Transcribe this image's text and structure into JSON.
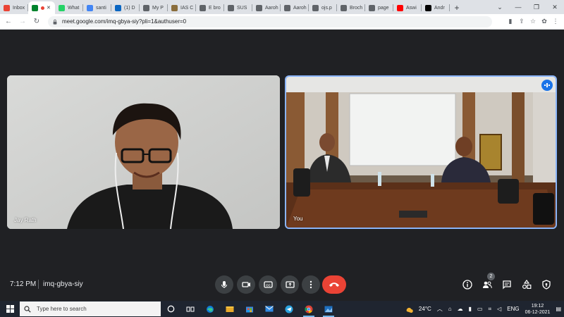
{
  "browser": {
    "tabs": [
      {
        "label": "Inbox",
        "icon": "gmail-icon",
        "color": "#ea4335"
      },
      {
        "label": "",
        "icon": "meet-icon",
        "color": "#00832d",
        "active": true
      },
      {
        "label": "What",
        "icon": "whatsapp-icon",
        "color": "#25d366"
      },
      {
        "label": "santi",
        "icon": "google-icon",
        "color": "#4285f4"
      },
      {
        "label": "(1) D",
        "icon": "linkedin-icon",
        "color": "#0a66c2"
      },
      {
        "label": "My P",
        "icon": "globe-icon",
        "color": "#5f6368"
      },
      {
        "label": "IAS C",
        "icon": "ias-icon",
        "color": "#8a6d3b"
      },
      {
        "label": "E bro",
        "icon": "globe-icon",
        "color": "#5f6368"
      },
      {
        "label": "SUS",
        "icon": "globe-icon",
        "color": "#5f6368"
      },
      {
        "label": "Aaroh",
        "icon": "globe-icon",
        "color": "#5f6368"
      },
      {
        "label": "Aaroh",
        "icon": "globe-icon",
        "color": "#5f6368"
      },
      {
        "label": "ojs.p",
        "icon": "globe-icon",
        "color": "#5f6368"
      },
      {
        "label": "Broch",
        "icon": "brochure-icon",
        "color": "#5f6368"
      },
      {
        "label": "page",
        "icon": "globe-icon",
        "color": "#5f6368"
      },
      {
        "label": "Aswi",
        "icon": "youtube-icon",
        "color": "#ff0000"
      },
      {
        "label": "Andr",
        "icon": "wikipedia-icon",
        "color": "#000000"
      }
    ],
    "url": "meet.google.com/imq-gbya-siy?pli=1&authuser=0"
  },
  "meet": {
    "participants": [
      {
        "name": "Jay Rath"
      },
      {
        "name": "You"
      }
    ],
    "time": "7:12 PM",
    "meeting_code": "imq-gbya-siy",
    "people_count": "2",
    "end_call_color": "#ea4335",
    "accent_color": "#8ab4f8"
  },
  "taskbar": {
    "search_placeholder": "Type here to search",
    "weather": "24°C",
    "language": "ENG",
    "clock_time": "19:12",
    "clock_date": "06-12-2021"
  }
}
